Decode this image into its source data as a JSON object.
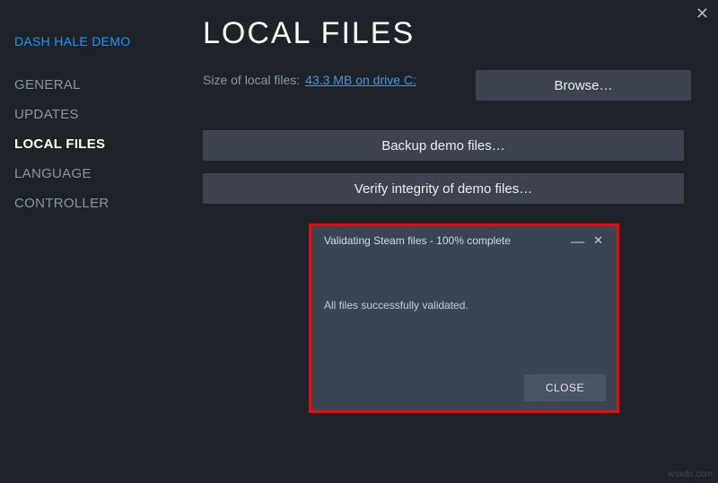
{
  "sidebar": {
    "game_title": "DASH HALE DEMO",
    "items": [
      {
        "label": "GENERAL"
      },
      {
        "label": "UPDATES"
      },
      {
        "label": "LOCAL FILES"
      },
      {
        "label": "LANGUAGE"
      },
      {
        "label": "CONTROLLER"
      }
    ],
    "active_index": 2
  },
  "main": {
    "title": "LOCAL FILES",
    "size_label": "Size of local files:",
    "size_value": "43.3 MB on drive C:",
    "browse_label": "Browse…",
    "backup_label": "Backup demo files…",
    "verify_label": "Verify integrity of demo files…"
  },
  "dialog": {
    "title": "Validating Steam files - 100% complete",
    "message": "All files successfully validated.",
    "close_label": "CLOSE"
  },
  "watermark": "wsxdn.com"
}
